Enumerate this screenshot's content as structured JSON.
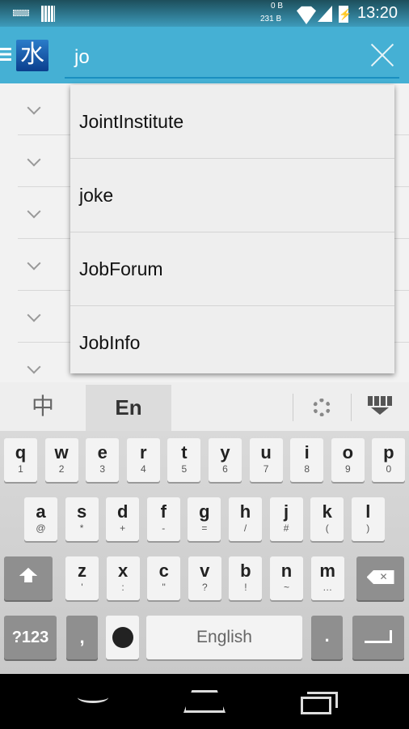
{
  "status": {
    "data_up": "0 B",
    "data_down": "231 B",
    "time": "13:20"
  },
  "appbar": {
    "logo_char": "水",
    "search_value": "jo"
  },
  "suggestions": [
    "JointInstitute",
    "joke",
    "JobForum",
    "JobInfo"
  ],
  "keyboard": {
    "lang_zh": "中",
    "lang_en": "En",
    "row1": [
      [
        "q",
        "1"
      ],
      [
        "w",
        "2"
      ],
      [
        "e",
        "3"
      ],
      [
        "r",
        "4"
      ],
      [
        "t",
        "5"
      ],
      [
        "y",
        "6"
      ],
      [
        "u",
        "7"
      ],
      [
        "i",
        "8"
      ],
      [
        "o",
        "9"
      ],
      [
        "p",
        "0"
      ]
    ],
    "row2": [
      [
        "a",
        "@"
      ],
      [
        "s",
        "*"
      ],
      [
        "d",
        "+"
      ],
      [
        "f",
        "-"
      ],
      [
        "g",
        "="
      ],
      [
        "h",
        "/"
      ],
      [
        "j",
        "#"
      ],
      [
        "k",
        "("
      ],
      [
        "l",
        ")"
      ]
    ],
    "row3": [
      [
        "z",
        "'"
      ],
      [
        "x",
        ":"
      ],
      [
        "c",
        "\""
      ],
      [
        "v",
        "?"
      ],
      [
        "b",
        "!"
      ],
      [
        "n",
        "~"
      ],
      [
        "m",
        "…"
      ]
    ],
    "symbols": "?123",
    "comma": ",",
    "space": "English",
    "period": "."
  },
  "colors": {
    "accent": "#45b0d4"
  }
}
